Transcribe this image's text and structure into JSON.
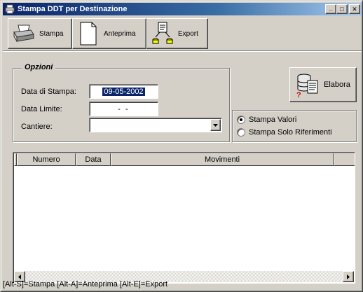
{
  "window": {
    "title": "Stampa DDT per Destinazione",
    "controls": {
      "minimize": "_",
      "maximize": "□",
      "close": "✕"
    }
  },
  "toolbar": {
    "buttons": [
      {
        "label": "Stampa",
        "icon": "printer-icon"
      },
      {
        "label": "Anteprima",
        "icon": "page-preview-icon"
      },
      {
        "label": "Export",
        "icon": "export-icon"
      }
    ]
  },
  "options": {
    "legend": "Opzioni",
    "data_stampa_label": "Data di Stampa:",
    "data_stampa_value": "09-05-2002",
    "data_limite_label": "Data Limite:",
    "data_limite_value": "- -",
    "cantiere_label": "Cantiere:",
    "cantiere_value": ""
  },
  "elabora": {
    "label": "Elabora",
    "icon": "database-process-icon"
  },
  "radio": {
    "options": [
      {
        "label": "Stampa Valori",
        "selected": true
      },
      {
        "label": "Stampa Solo Riferimenti",
        "selected": false
      }
    ]
  },
  "grid": {
    "columns": [
      "",
      "Numero",
      "Data",
      "Movimenti",
      ""
    ]
  },
  "status": {
    "text": "[Alt-S]=Stampa [Alt-A]=Anteprima [Alt-E]=Export"
  }
}
